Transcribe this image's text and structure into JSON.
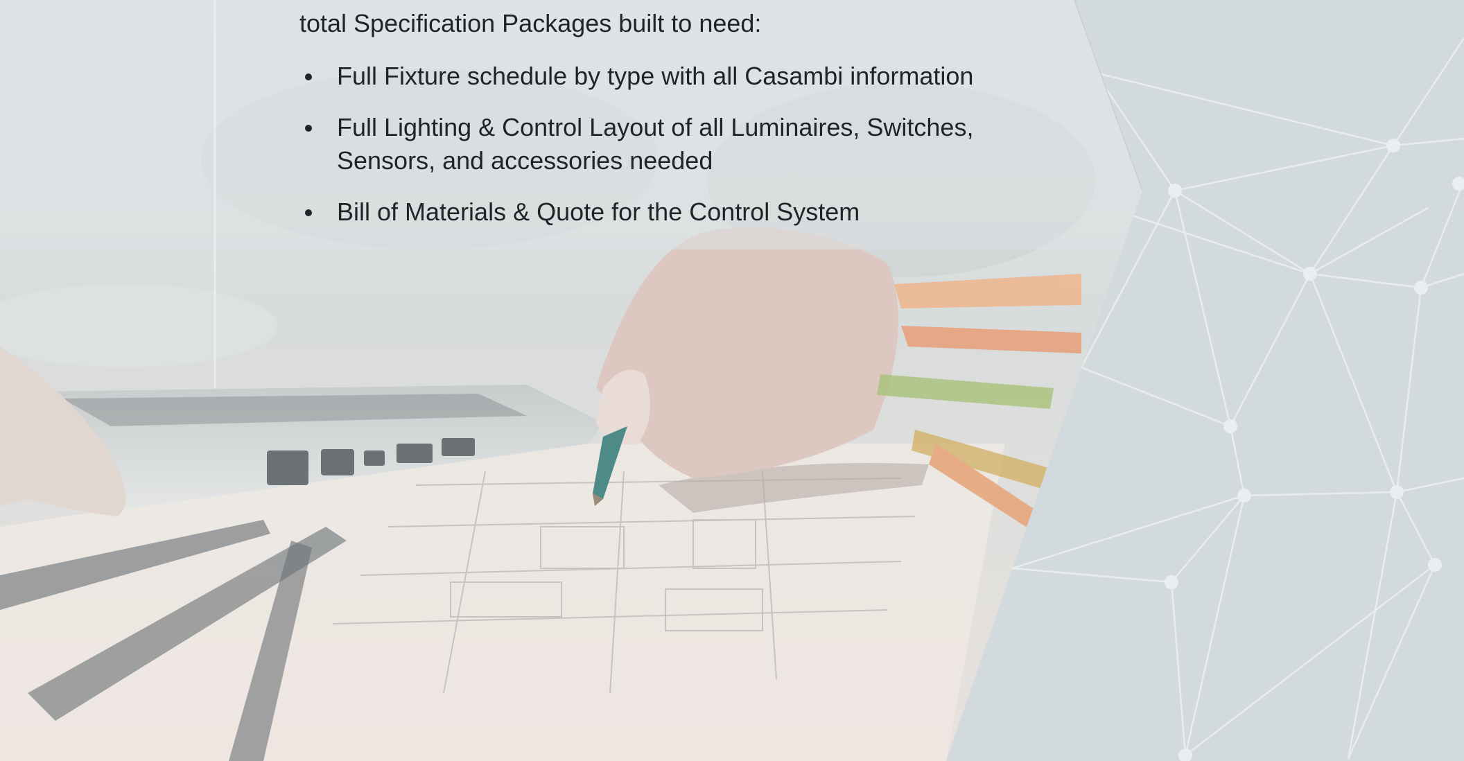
{
  "page": {
    "intro_text": "total Specification Packages built to need:",
    "bullets": [
      "Full Fixture schedule by type with all Casambi information",
      "Full Lighting & Control Layout of all Luminaires, Switches, Sensors, and accessories needed",
      "Bill of Materials & Quote for the Control System"
    ]
  },
  "colors": {
    "background": "#d3dadd",
    "text": "#1f2426",
    "network_lines": "#eef1f2"
  },
  "icons": [
    "bullet-dot-icon"
  ]
}
